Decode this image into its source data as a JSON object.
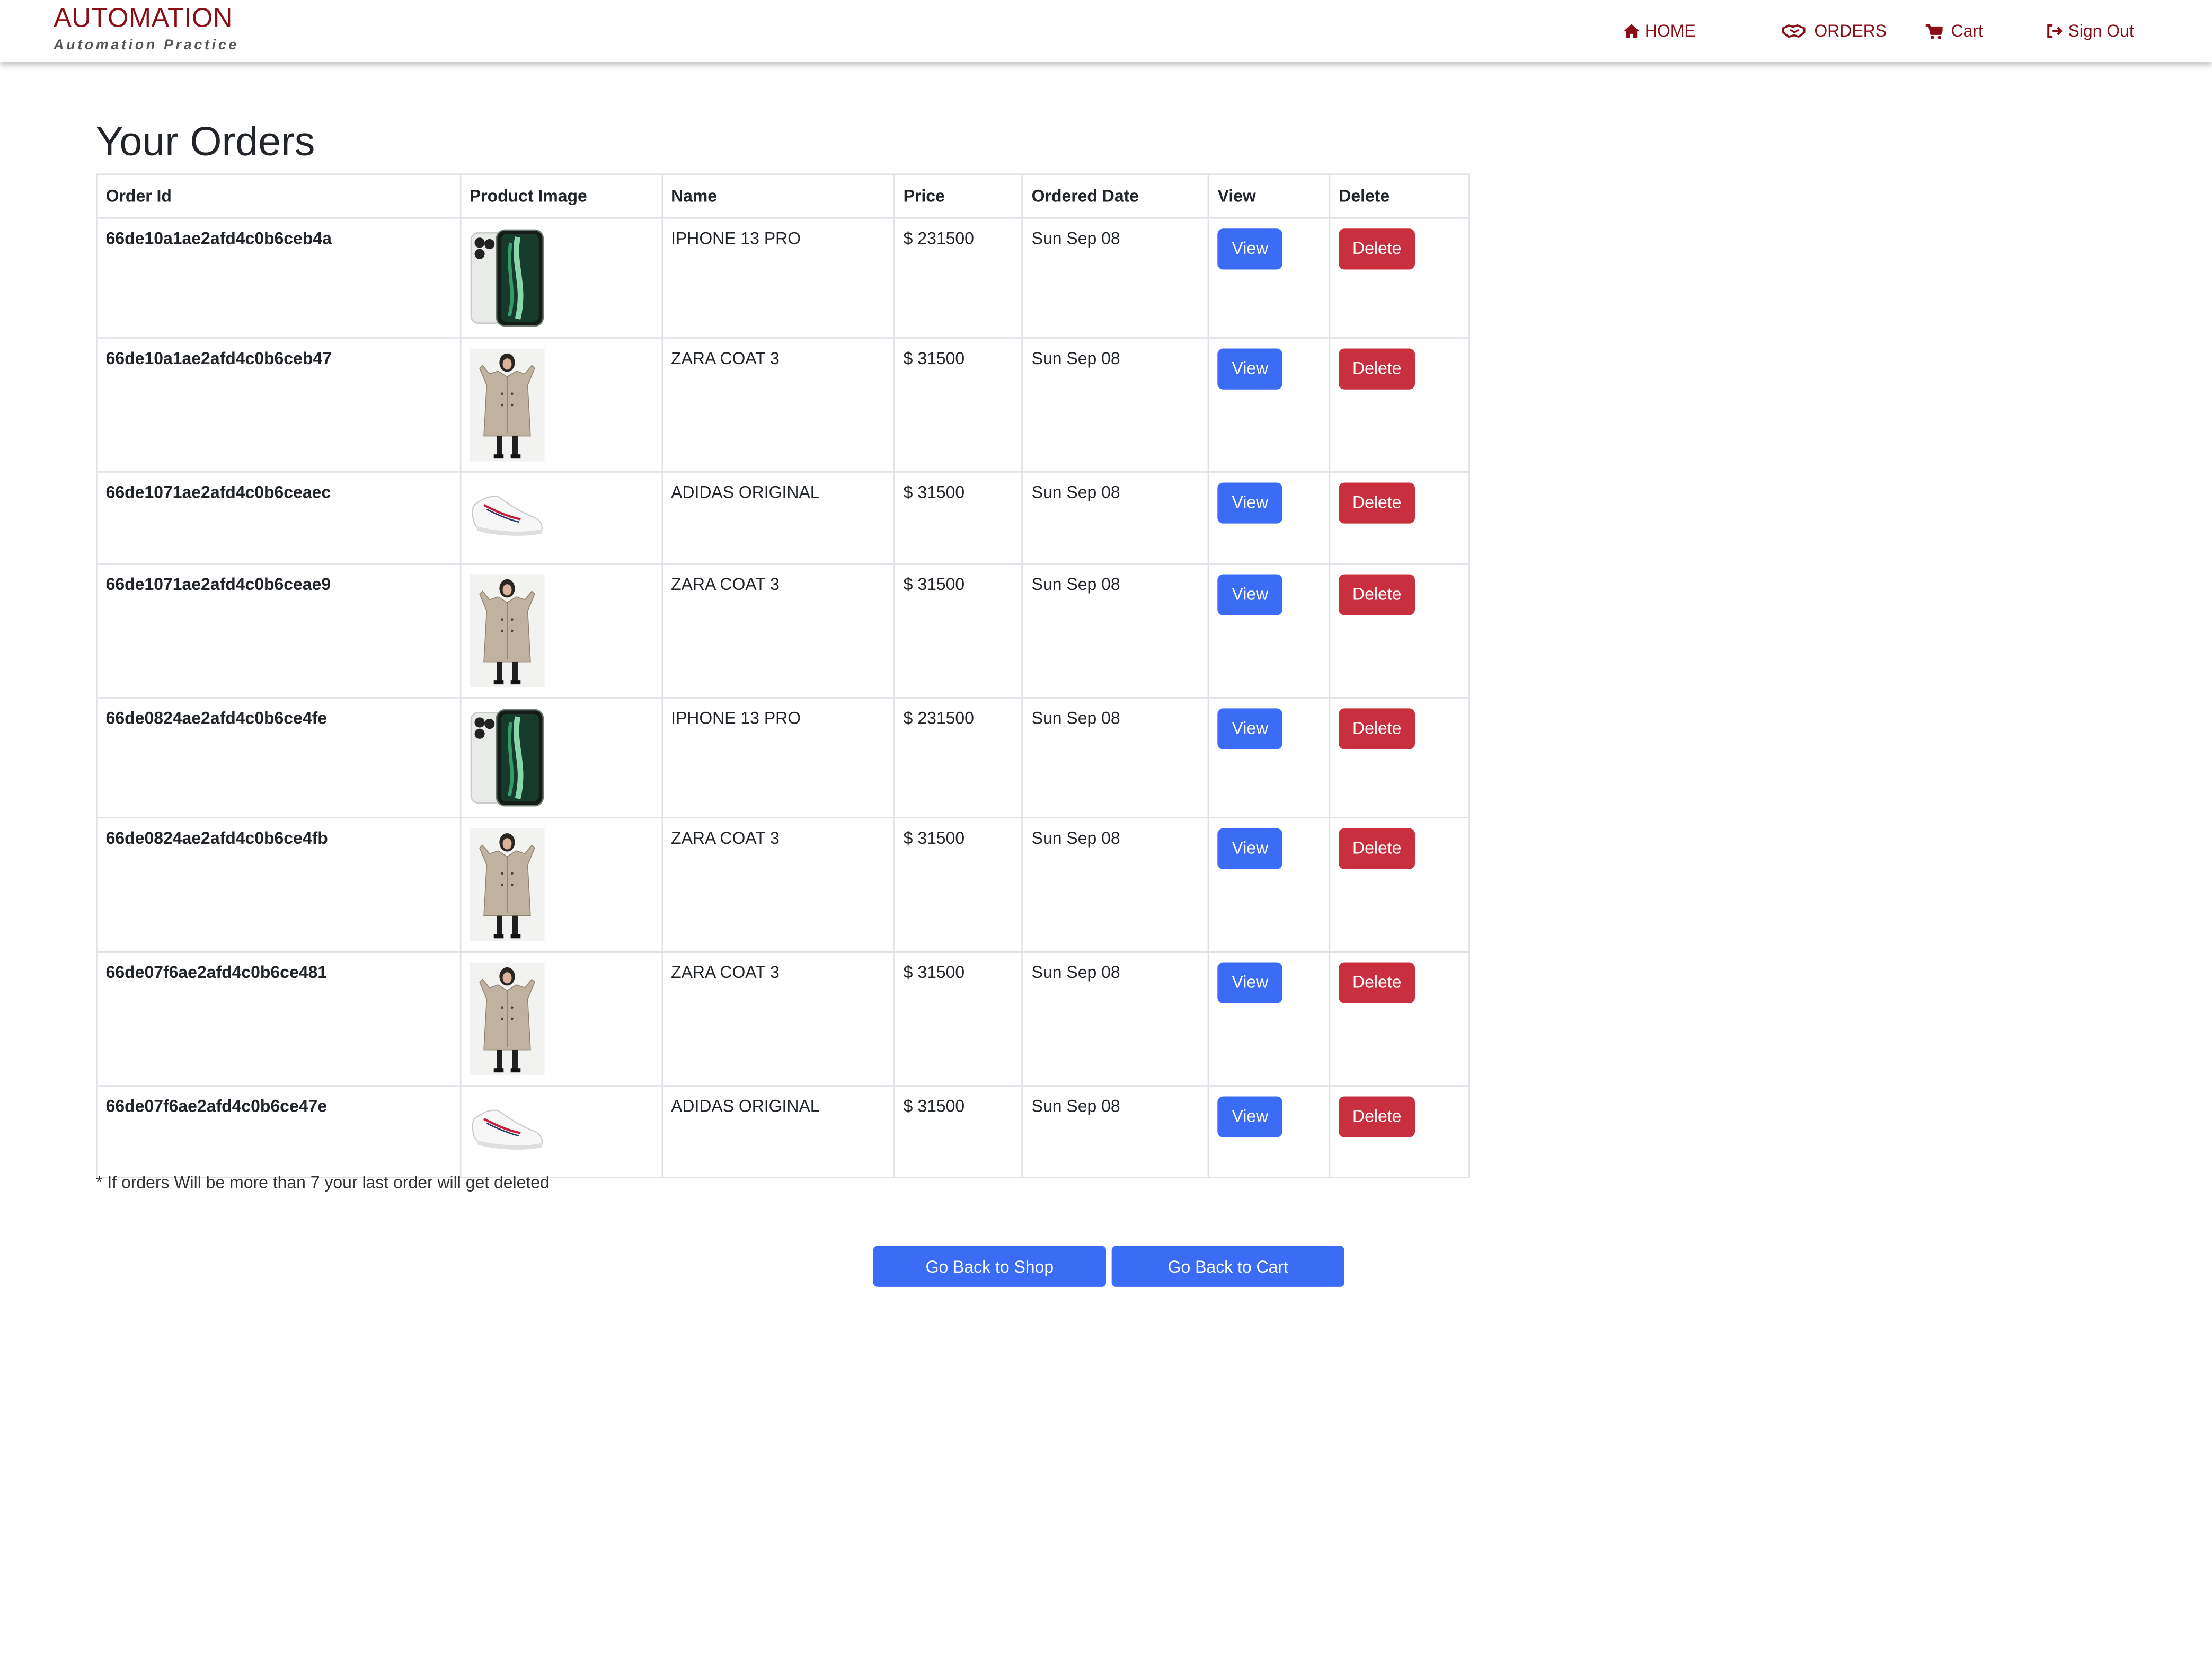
{
  "brand": {
    "title": "AUTOMATION",
    "subtitle": "Automation Practice"
  },
  "nav": {
    "home": "HOME",
    "orders": "ORDERS",
    "cart": "Cart",
    "signout": "Sign Out"
  },
  "page": {
    "title": "Your Orders"
  },
  "table": {
    "headers": [
      "Order Id",
      "Product Image",
      "Name",
      "Price",
      "Ordered Date",
      "View",
      "Delete"
    ],
    "rows": [
      {
        "order_id": "66de10a1ae2afd4c0b6ceb4a",
        "image": "iphone",
        "name": "IPHONE 13 PRO",
        "price": "$ 231500",
        "date": "Sun Sep 08"
      },
      {
        "order_id": "66de10a1ae2afd4c0b6ceb47",
        "image": "coat",
        "name": "ZARA COAT 3",
        "price": "$ 31500",
        "date": "Sun Sep 08"
      },
      {
        "order_id": "66de1071ae2afd4c0b6ceaec",
        "image": "shoe",
        "name": "ADIDAS ORIGINAL",
        "price": "$ 31500",
        "date": "Sun Sep 08"
      },
      {
        "order_id": "66de1071ae2afd4c0b6ceae9",
        "image": "coat",
        "name": "ZARA COAT 3",
        "price": "$ 31500",
        "date": "Sun Sep 08"
      },
      {
        "order_id": "66de0824ae2afd4c0b6ce4fe",
        "image": "iphone",
        "name": "IPHONE 13 PRO",
        "price": "$ 231500",
        "date": "Sun Sep 08"
      },
      {
        "order_id": "66de0824ae2afd4c0b6ce4fb",
        "image": "coat",
        "name": "ZARA COAT 3",
        "price": "$ 31500",
        "date": "Sun Sep 08"
      },
      {
        "order_id": "66de07f6ae2afd4c0b6ce481",
        "image": "coat",
        "name": "ZARA COAT 3",
        "price": "$ 31500",
        "date": "Sun Sep 08"
      },
      {
        "order_id": "66de07f6ae2afd4c0b6ce47e",
        "image": "shoe",
        "name": "ADIDAS ORIGINAL",
        "price": "$ 31500",
        "date": "Sun Sep 08"
      }
    ],
    "view_label": "View",
    "delete_label": "Delete"
  },
  "note": "* If orders Will be more than 7 your last order will get deleted",
  "actions": {
    "back_to_shop": "Go Back to Shop",
    "back_to_cart": "Go Back to Cart"
  },
  "colors": {
    "brand": "#8b0e17",
    "primary": "#3b6cf6",
    "danger": "#c8303f"
  }
}
